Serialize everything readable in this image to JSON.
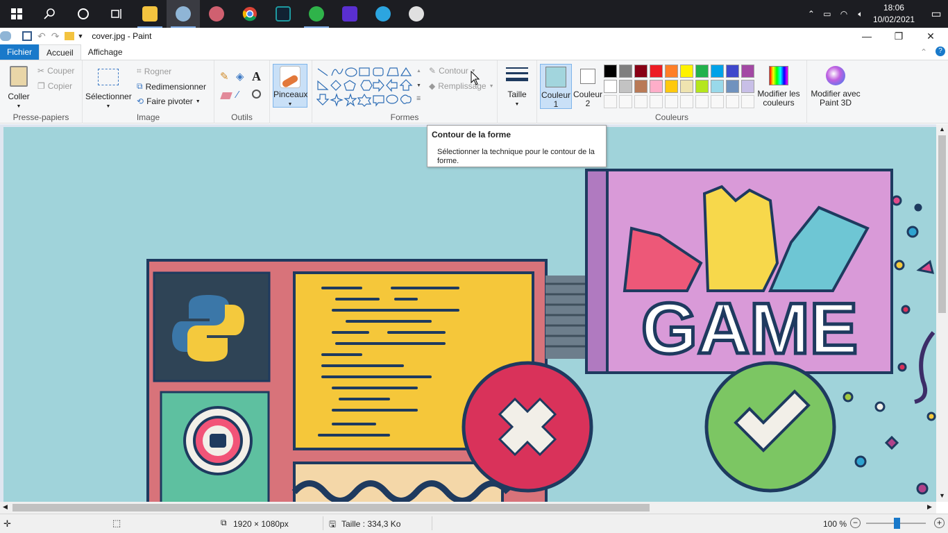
{
  "taskbar": {
    "apps": [
      {
        "name": "file-explorer",
        "color": "#f3c33f"
      },
      {
        "name": "paint",
        "color": "#8fb5d6",
        "active": true
      },
      {
        "name": "paint-3d",
        "color": "#d06070"
      },
      {
        "name": "chrome",
        "color": "#4285f4"
      },
      {
        "name": "editor",
        "color": "#1e9aa0"
      },
      {
        "name": "globe-app",
        "color": "#2fb34a"
      },
      {
        "name": "jetbrains",
        "color": "#5a2fd0"
      },
      {
        "name": "telegram",
        "color": "#2ca5e0"
      },
      {
        "name": "hand-app",
        "color": "#e0e0e0"
      }
    ],
    "clock_time": "18:06",
    "clock_date": "10/02/2021"
  },
  "window": {
    "title": "cover.jpg - Paint"
  },
  "menu": {
    "file": "Fichier",
    "home": "Accueil",
    "view": "Affichage"
  },
  "clipboard": {
    "paste": "Coller",
    "cut": "Couper",
    "copy": "Copier",
    "label": "Presse-papiers"
  },
  "image": {
    "select": "Sélectionner",
    "crop": "Rogner",
    "resize": "Redimensionner",
    "rotate": "Faire pivoter",
    "label": "Image"
  },
  "tools": {
    "label": "Outils"
  },
  "brushes": {
    "label": "Pinceaux"
  },
  "shapes": {
    "outline": "Contour",
    "fill": "Remplissage",
    "label": "Formes"
  },
  "size": {
    "label": "Taille"
  },
  "colors": {
    "color1": "Couleur 1",
    "color2": "Couleur 2",
    "color1_value": "#a2d5dd",
    "color2_value": "#ffffff",
    "edit": "Modifier les couleurs",
    "label": "Couleurs",
    "palette_row1": [
      "#000000",
      "#7f7f7f",
      "#880015",
      "#ed1c24",
      "#ff7f27",
      "#fff200",
      "#22b14c",
      "#00a2e8",
      "#3f48cc",
      "#a349a4"
    ],
    "palette_row2": [
      "#ffffff",
      "#c3c3c3",
      "#b97a57",
      "#ffaec9",
      "#ffc90e",
      "#efe4b0",
      "#b5e61d",
      "#99d9ea",
      "#7092be",
      "#c8bfe7"
    ]
  },
  "paint3d": {
    "label": "Modifier avec Paint 3D"
  },
  "tooltip": {
    "title": "Contour de la forme",
    "body": "Sélectionner la technique pour le contour de la forme."
  },
  "artwork": {
    "game_text": "GAME",
    "background": "#a0d3da"
  },
  "status": {
    "dimensions": "1920 × 1080px",
    "size": "Taille : 334,3 Ko",
    "zoom": "100 %"
  }
}
